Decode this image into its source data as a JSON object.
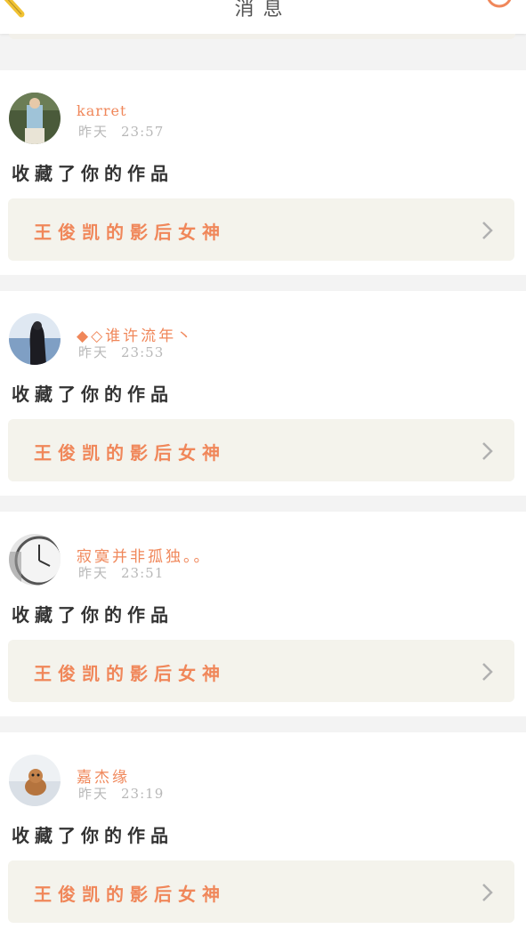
{
  "header": {
    "title": "消息",
    "back_icon": "back-icon",
    "search_icon": "search-icon"
  },
  "colors": {
    "accent": "#f0875a",
    "work_bg": "#f4f3ec",
    "divider_bg": "#f3f3f3"
  },
  "notifications": [
    {
      "username": "karret",
      "day": "昨天",
      "time": "23:57",
      "action": "收藏了你的作品",
      "work_title": "王俊凯的影后女神"
    },
    {
      "username": "◆◇谁许流年丶",
      "day": "昨天",
      "time": "23:53",
      "action": "收藏了你的作品",
      "work_title": "王俊凯的影后女神"
    },
    {
      "username": "寂寞并非孤独。。",
      "day": "昨天",
      "time": "23:51",
      "action": "收藏了你的作品",
      "work_title": "王俊凯的影后女神"
    },
    {
      "username": "嘉杰缘",
      "day": "昨天",
      "time": "23:19",
      "action": "收藏了你的作品",
      "work_title": "王俊凯的影后女神"
    }
  ]
}
